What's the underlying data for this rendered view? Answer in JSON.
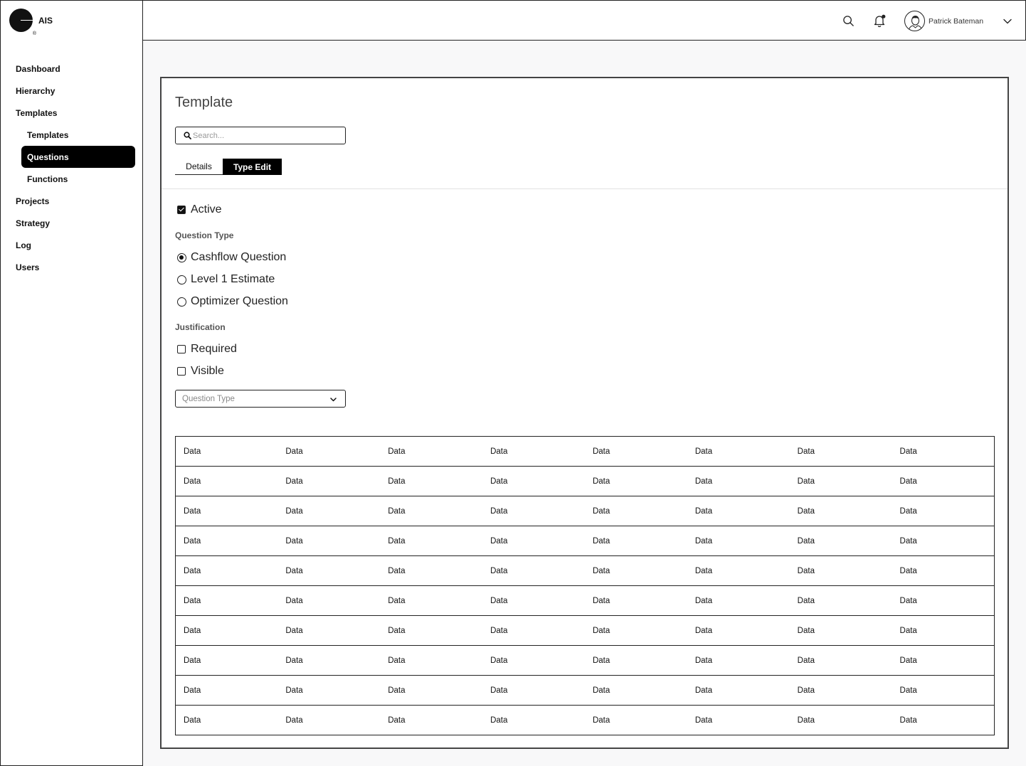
{
  "brand": {
    "name": "AIS"
  },
  "header": {
    "user_name": "Patrick Bateman",
    "icons": [
      "search-icon",
      "bell-icon",
      "avatar",
      "chevron-down-icon"
    ],
    "notification_dot": true
  },
  "sidebar": {
    "items": [
      {
        "label": "Dashboard"
      },
      {
        "label": "Hierarchy"
      },
      {
        "label": "Templates"
      },
      {
        "label": "Templates"
      },
      {
        "label": "Questions",
        "active": true
      },
      {
        "label": "Functions"
      },
      {
        "label": "Projects"
      },
      {
        "label": "Strategy"
      },
      {
        "label": "Log"
      },
      {
        "label": "Users"
      }
    ]
  },
  "main": {
    "title": "Template",
    "search": {
      "placeholder": "Search...",
      "value": ""
    },
    "tabs": [
      {
        "label": "Details",
        "active": false
      },
      {
        "label": "Type Edit",
        "active": true
      }
    ],
    "active_checkbox": {
      "label": "Active",
      "checked": true
    },
    "question_type": {
      "label": "Question Type",
      "options": [
        {
          "label": "Cashflow Question",
          "selected": true
        },
        {
          "label": "Level 1 Estimate",
          "selected": false
        },
        {
          "label": "Optimizer Question",
          "selected": false
        }
      ]
    },
    "justification": {
      "label": "Justification",
      "options": [
        {
          "label": "Required",
          "checked": false
        },
        {
          "label": "Visible",
          "checked": false
        }
      ]
    },
    "select": {
      "placeholder": "Question Type"
    },
    "table": {
      "rows": [
        [
          "Data",
          "Data",
          "Data",
          "Data",
          "Data",
          "Data",
          "Data",
          "Data"
        ],
        [
          "Data",
          "Data",
          "Data",
          "Data",
          "Data",
          "Data",
          "Data",
          "Data"
        ],
        [
          "Data",
          "Data",
          "Data",
          "Data",
          "Data",
          "Data",
          "Data",
          "Data"
        ],
        [
          "Data",
          "Data",
          "Data",
          "Data",
          "Data",
          "Data",
          "Data",
          "Data"
        ],
        [
          "Data",
          "Data",
          "Data",
          "Data",
          "Data",
          "Data",
          "Data",
          "Data"
        ],
        [
          "Data",
          "Data",
          "Data",
          "Data",
          "Data",
          "Data",
          "Data",
          "Data"
        ],
        [
          "Data",
          "Data",
          "Data",
          "Data",
          "Data",
          "Data",
          "Data",
          "Data"
        ],
        [
          "Data",
          "Data",
          "Data",
          "Data",
          "Data",
          "Data",
          "Data",
          "Data"
        ],
        [
          "Data",
          "Data",
          "Data",
          "Data",
          "Data",
          "Data",
          "Data",
          "Data"
        ],
        [
          "Data",
          "Data",
          "Data",
          "Data",
          "Data",
          "Data",
          "Data",
          "Data"
        ]
      ]
    }
  }
}
